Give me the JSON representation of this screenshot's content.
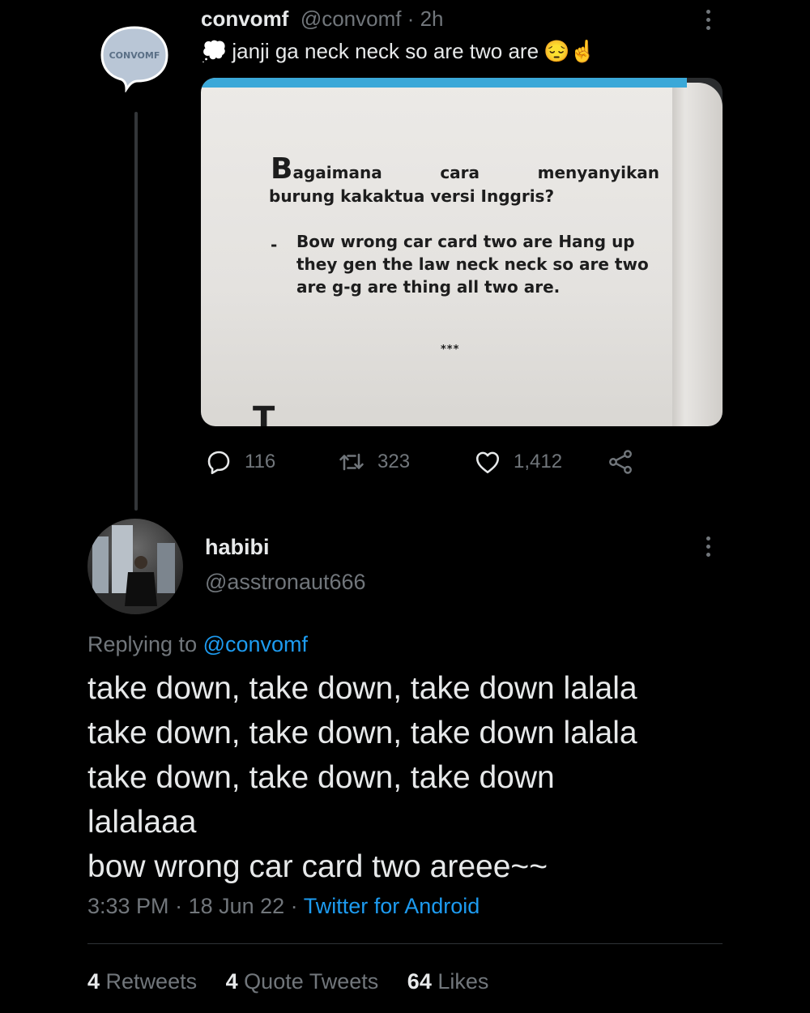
{
  "tweet1": {
    "display_name": "convomf",
    "handle": "@convomf",
    "separator": " · ",
    "time": "2h",
    "avatar_text": "CONVOMF",
    "text": "janji ga neck neck so are two are",
    "emoji_lead": "💭",
    "emoji_trail": "😔☝️",
    "photo": {
      "q_big_letter": "B",
      "q_word1": "agaimana",
      "q_word2": "cara",
      "q_word3": "menyanyikan",
      "q_line2": "burung kakaktua versi Inggris?",
      "a_dash": "-",
      "a_body": "Bow wrong car card two are Hang up they gen the law neck neck so are two are g-g are thing all two are.",
      "stars": "***",
      "bottom_letter": "T"
    },
    "actions": {
      "replies": "116",
      "retweets": "323",
      "likes": "1,412"
    }
  },
  "tweet2": {
    "display_name": "habibi",
    "handle": "@asstronaut666",
    "replying_prefix": "Replying to ",
    "replying_handle": "@convomf",
    "lines": [
      "take down, take down, take down lalala",
      "take down, take down, take down lalala",
      "take down, take down, take down",
      "lalalaaa",
      "bow wrong car card two areee~~"
    ],
    "time": "3:33 PM",
    "date": "18 Jun 22",
    "source": "Twitter for Android",
    "stats": {
      "retweets_count": "4",
      "retweets_label": "Retweets",
      "quotes_count": "4",
      "quotes_label": "Quote Tweets",
      "likes_count": "64",
      "likes_label": "Likes"
    }
  },
  "colors": {
    "background": "#000000",
    "text": "#e7e9ea",
    "muted": "#71767b",
    "link": "#1d9bf0"
  }
}
